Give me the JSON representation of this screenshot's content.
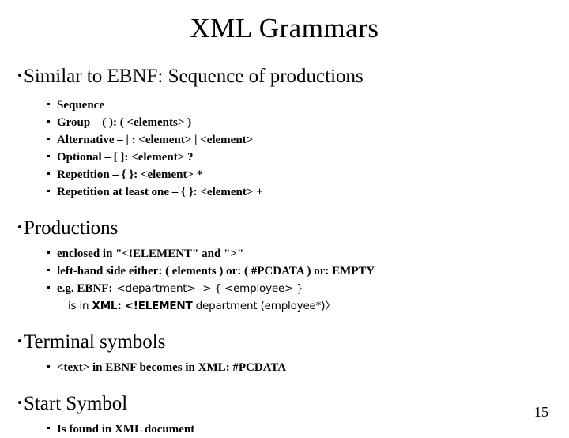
{
  "slide": {
    "title": "XML Grammars",
    "page_number": "15",
    "bullet_glyph": "•",
    "sections": [
      {
        "heading": "Similar to EBNF: Sequence of productions",
        "items": [
          "Sequence",
          "Group – ( ): ( <elements> )",
          "Alternative – | : <element> | <element>",
          "Optional – [ ]:  <element> ?",
          "Repetition – { }: <element> *",
          "Repetition at least one – { }: <element> +"
        ]
      },
      {
        "heading": "Productions",
        "items": [
          "enclosed in \"<!ELEMENT\" and \">\"",
          "left-hand side either: ( elements ) or: ( #PCDATA ) or: EMPTY"
        ],
        "example": {
          "lead": "e.g. EBNF:",
          "ebnf": "<department> -> { <employee> }",
          "cont_lead": "is in",
          "cont_label": "XML:",
          "cont_decl": "<!ELEMENT",
          "cont_rest": " department (employee*)〉"
        }
      },
      {
        "heading": "Terminal symbols",
        "items": [
          "<text> in EBNF becomes in XML: #PCDATA"
        ]
      },
      {
        "heading": "Start Symbol",
        "items": [
          "Is found in XML document"
        ]
      }
    ]
  }
}
